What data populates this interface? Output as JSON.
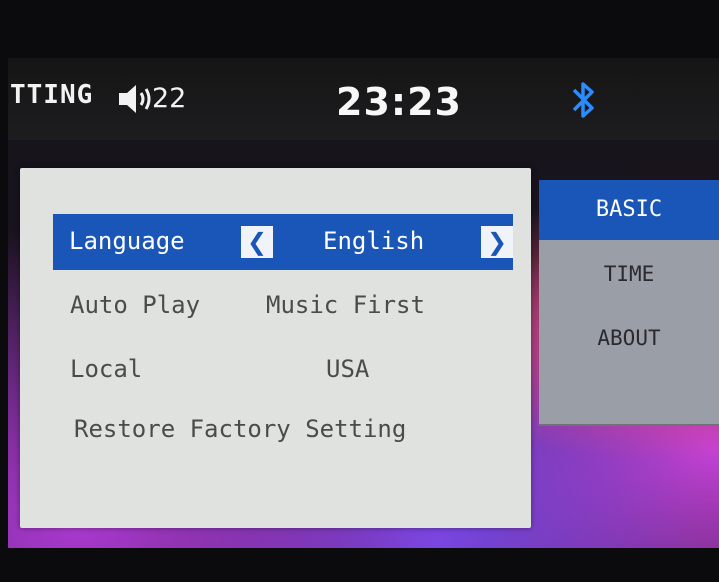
{
  "status_bar": {
    "title": "TTING",
    "volume_icon": "speaker-icon",
    "volume": "22",
    "clock": "23:23",
    "bluetooth_icon": "bluetooth-icon",
    "bluetooth_color": "#2a8cff"
  },
  "settings": {
    "rows": [
      {
        "label": "Language",
        "value": "English",
        "selected": true
      },
      {
        "label": "Auto Play",
        "value": "Music First",
        "selected": false
      },
      {
        "label": "Local",
        "value": "USA",
        "selected": false
      },
      {
        "label": "Restore Factory Setting",
        "value": "",
        "selected": false
      }
    ],
    "prev_icon": "chevron-left-icon",
    "next_icon": "chevron-right-icon"
  },
  "tabs": {
    "items": [
      {
        "label": "BASIC",
        "active": true
      },
      {
        "label": "TIME",
        "active": false
      },
      {
        "label": "ABOUT",
        "active": false
      }
    ]
  },
  "colors": {
    "accent": "#1a56b8",
    "panel": "#dfe2df",
    "tab_inactive": "#9a9ea6"
  }
}
